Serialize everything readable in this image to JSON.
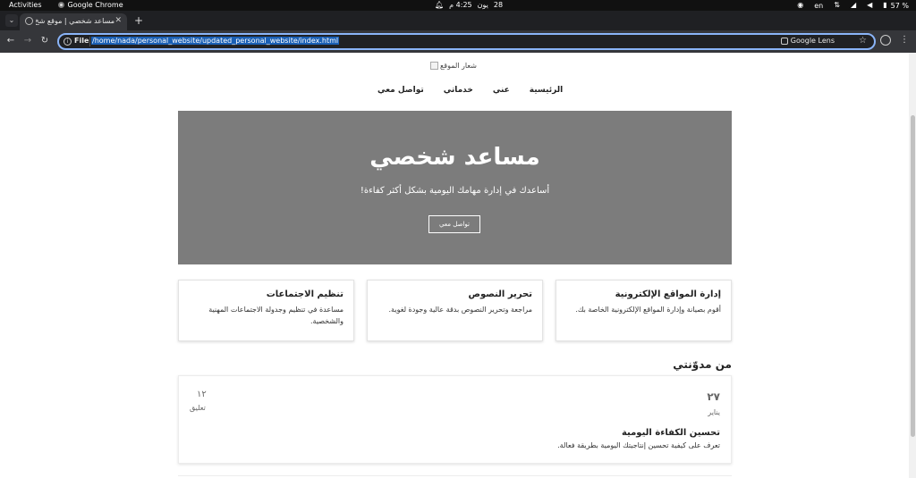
{
  "system": {
    "activities": "Activities",
    "app_name": "Google Chrome",
    "clock_day": "28",
    "clock_month": "يون",
    "clock_time": "4:25 م",
    "lang": "en",
    "battery": "57 %"
  },
  "browser": {
    "tab_title": "مساعد شخصي | موقع شخ",
    "url_scheme": "File",
    "url": "/home/nada/personal_website/updated_personal_website/index.html",
    "lens_label": "Google Lens"
  },
  "page": {
    "logo_alt": "شعار الموقع",
    "nav": [
      "الرئيسية",
      "عني",
      "خدماتي",
      "تواصل معي"
    ],
    "hero": {
      "title": "مساعد شخصي",
      "subtitle": "أساعدك في إدارة مهامك اليومية بشكل أكثر كفاءة!",
      "cta": "تواصل معي"
    },
    "services": [
      {
        "title": "إدارة المواقع الإلكترونية",
        "desc": "أقوم بصيانة وإدارة المواقع الإلكترونية الخاصة بك."
      },
      {
        "title": "تحرير النصوص",
        "desc": "مراجعة وتحرير النصوص بدقة عالية وجودة لغوية."
      },
      {
        "title": "تنظيم الاجتماعات",
        "desc": "مساعدة في تنظيم وجدولة الاجتماعات المهنية والشخصية."
      }
    ],
    "blog": {
      "heading": "من مدوّنتي",
      "post": {
        "day": "٢٧",
        "month": "يناير",
        "comments_count": "١٢",
        "comments_label": "تعليق",
        "title": "تحسين الكفاءة اليومية",
        "excerpt": "تعرف على كيفية تحسين إنتاجيتك اليومية بطريقة فعالة."
      }
    }
  }
}
